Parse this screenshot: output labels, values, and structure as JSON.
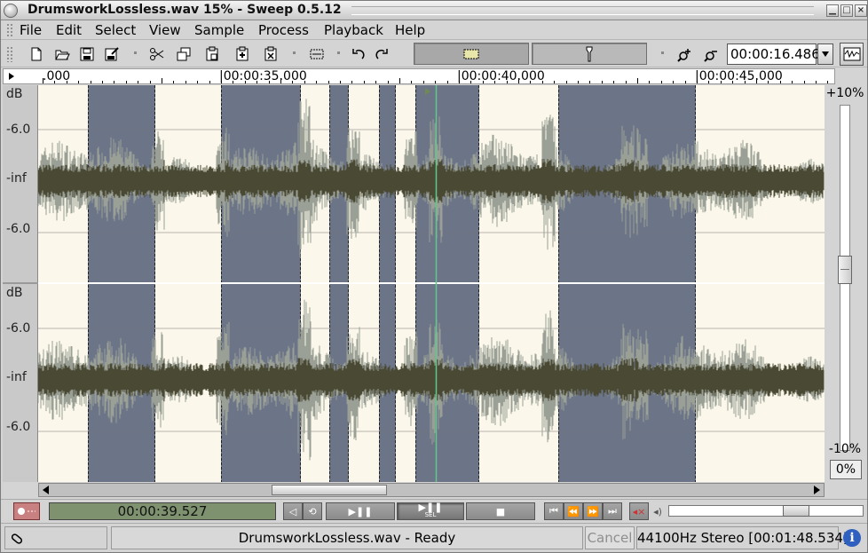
{
  "window": {
    "title": "DrumsworkLossless.wav 15% - Sweep 0.5.12"
  },
  "menubar": {
    "items": [
      "File",
      "Edit",
      "Select",
      "View",
      "Sample",
      "Process",
      "Playback",
      "Help"
    ]
  },
  "toolbar": {
    "icons": [
      "new-icon",
      "open-icon",
      "save-icon",
      "save-as-icon",
      "cut-icon",
      "copy-icon",
      "paste-icon",
      "paste-mix-icon",
      "paste-xfade-icon",
      "crop-icon",
      "undo-icon",
      "redo-icon",
      "select-tool-icon",
      "scrub-tool-icon",
      "zoom-in-icon",
      "zoom-out-icon"
    ],
    "position_time": "00:00:16.486"
  },
  "ruler": {
    "labels": [
      ".000",
      "|00:00:35.000",
      "|00:00:40.000",
      "|00:00:45.000"
    ]
  },
  "tracks": {
    "channel1": {
      "unit": "dB",
      "upper": "-6.0",
      "middle": "-inf",
      "lower": "-6.0"
    },
    "channel2": {
      "unit": "dB",
      "upper": "-6.0",
      "middle": "-inf",
      "lower": "-6.0"
    }
  },
  "vscale": {
    "top": "+10%",
    "bottom": "-10%",
    "reset": "0%"
  },
  "transport": {
    "time": "00:00:39.527",
    "play_sel_label": "SEL"
  },
  "status": {
    "message": "DrumsworkLossless.wav - Ready",
    "cancel": "Cancel",
    "info": "44100Hz Stereo [00:01:48.534]"
  },
  "colors": {
    "selection": "#6c7488",
    "background": "#fbf7ea",
    "wave_dark": "#4a4a34",
    "wave_light": "#9aa096",
    "cursor": "#5fc88a"
  }
}
